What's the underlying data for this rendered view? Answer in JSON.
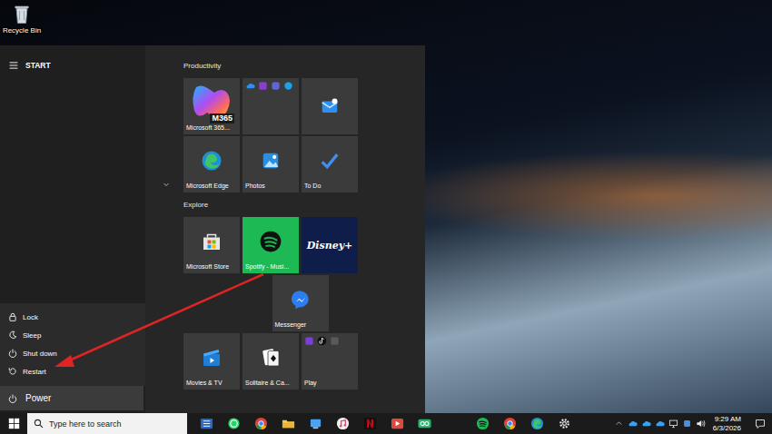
{
  "desktop": {
    "icons": [
      {
        "label": "Recycle Bin",
        "kind": "recycle-bin"
      }
    ]
  },
  "start_menu": {
    "header": {
      "title": "START"
    },
    "tile_groups": [
      {
        "title": "Productivity",
        "collapsible": true,
        "tiles": [
          {
            "label": "Microsoft 365...",
            "kind": "m365",
            "color": "#3b3b3b",
            "logo_text": "M365"
          },
          {
            "kind": "cluster",
            "color": "#3b3b3b"
          },
          {
            "kind": "outlook",
            "color": "#3b3b3b"
          },
          {
            "label": "Microsoft Edge",
            "kind": "edge",
            "color": "#3b3b3b"
          },
          {
            "label": "Photos",
            "kind": "photos",
            "color": "#3b3b3b"
          },
          {
            "label": "To Do",
            "kind": "todo",
            "color": "#3b3b3b"
          }
        ]
      },
      {
        "title": "Explore",
        "collapsible": false,
        "tiles": [
          {
            "label": "Microsoft Store",
            "kind": "store",
            "color": "#3b3b3b"
          },
          {
            "label": "Spotify - Musi...",
            "kind": "spotify",
            "color": "#1db954"
          },
          {
            "kind": "disney",
            "color": "#0f1d4a",
            "logo_text": "Disney+"
          },
          {
            "label": "Messenger",
            "kind": "messenger",
            "color": "#3b3b3b"
          },
          {
            "label": "Movies & TV",
            "kind": "movies",
            "color": "#3b3b3b"
          },
          {
            "label": "Solitaire & Ca...",
            "kind": "solitaire",
            "color": "#3b3b3b"
          },
          {
            "label": "Play",
            "kind": "play",
            "color": "#3b3b3b"
          }
        ]
      }
    ],
    "power_menu": {
      "open": true,
      "items": [
        {
          "label": "Lock",
          "kind": "lock",
          "selected": false
        },
        {
          "label": "Sleep",
          "kind": "sleep",
          "selected": false
        },
        {
          "label": "Shut down",
          "kind": "shutdown",
          "selected": false
        },
        {
          "label": "Restart",
          "kind": "restart",
          "selected": false
        }
      ]
    },
    "power_button": {
      "label": "Power",
      "selected": true
    }
  },
  "taskbar": {
    "search": {
      "placeholder": "Type here to search"
    },
    "pinned": [
      {
        "kind": "word"
      },
      {
        "kind": "whatsapp"
      },
      {
        "kind": "chrome"
      },
      {
        "kind": "explorer"
      },
      {
        "kind": "app-blue"
      },
      {
        "kind": "itunes"
      },
      {
        "kind": "netflix"
      },
      {
        "kind": "app-red"
      },
      {
        "kind": "go"
      }
    ],
    "running": [
      {
        "kind": "spotify"
      },
      {
        "kind": "chrome"
      },
      {
        "kind": "edge"
      },
      {
        "kind": "settings"
      }
    ],
    "tray": [
      {
        "kind": "chevron"
      },
      {
        "kind": "cloud"
      },
      {
        "kind": "cloud"
      },
      {
        "kind": "cloud"
      },
      {
        "kind": "network"
      },
      {
        "kind": "app"
      },
      {
        "kind": "volume"
      }
    ],
    "clock": {
      "time": "9:29 AM",
      "date": "6/3/2026"
    }
  }
}
